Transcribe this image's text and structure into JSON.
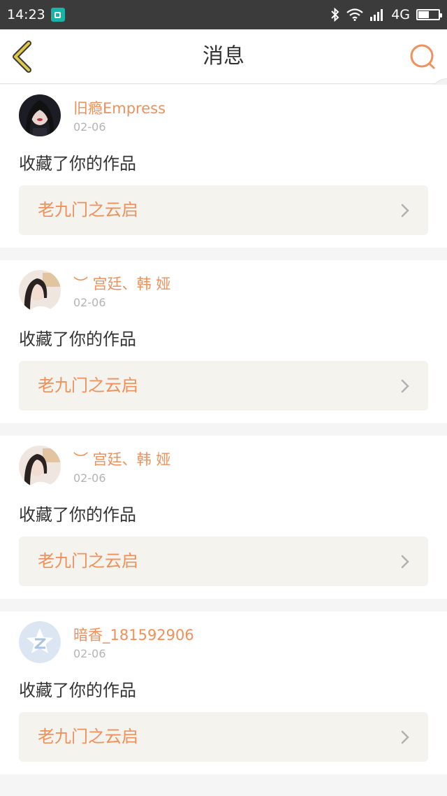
{
  "status_bar": {
    "time": "14:23",
    "network": "4G",
    "icons": [
      "screenshot-app-icon",
      "bluetooth-icon",
      "wifi-icon",
      "signal-icon",
      "battery-icon"
    ],
    "battery_level": 0.55
  },
  "header": {
    "title": "消息",
    "back_icon": "chevron-left-icon",
    "search_icon": "search-icon"
  },
  "colors": {
    "accent": "#f0905a",
    "back_icon": "#e0c84a",
    "status_bar": "#3b3b3b",
    "work_bg": "#f4f3ee"
  },
  "messages": [
    {
      "username": "旧瘾Empress",
      "date": "02-06",
      "action": "收藏了你的作品",
      "work_title": "老九门之云启",
      "avatar": "photo-avatar-dark"
    },
    {
      "username": "︶ 宫廷、韩 娅",
      "date": "02-06",
      "action": "收藏了你的作品",
      "work_title": "老九门之云启",
      "avatar": "photo-avatar-light"
    },
    {
      "username": "︶ 宫廷、韩 娅",
      "date": "02-06",
      "action": "收藏了你的作品",
      "work_title": "老九门之云启",
      "avatar": "photo-avatar-light"
    },
    {
      "username": "暗香_181592906",
      "date": "02-06",
      "action": "收藏了你的作品",
      "work_title": "老九门之云启",
      "avatar": "qzone-default-avatar"
    }
  ]
}
